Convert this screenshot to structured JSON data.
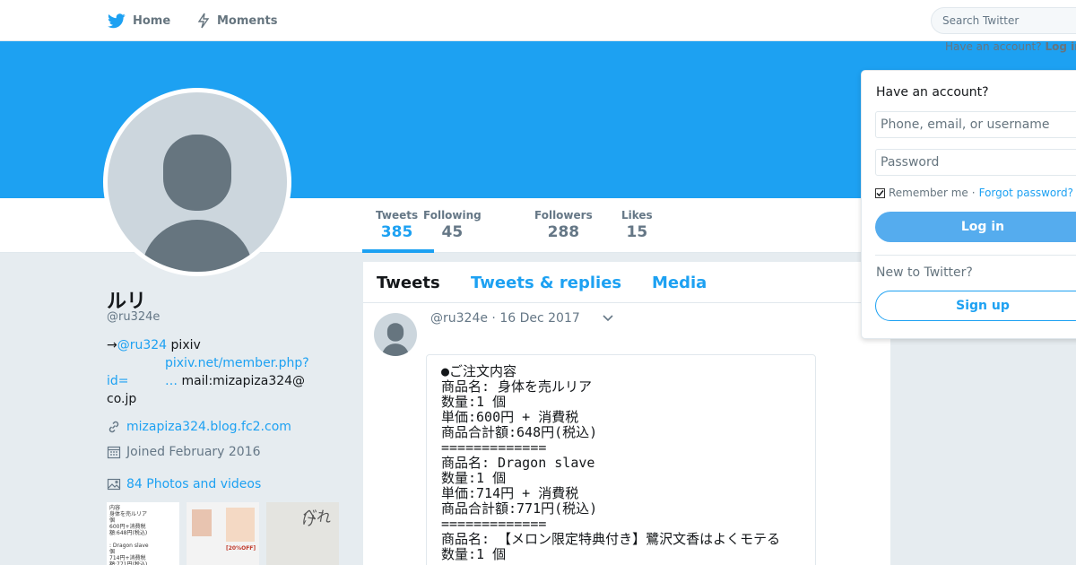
{
  "nav": {
    "home_label": "Home",
    "moments_label": "Moments",
    "search_placeholder": "Search Twitter"
  },
  "header": {
    "have_account_text": "Have an account?",
    "login_link": "Log in"
  },
  "profile": {
    "name": "ルリ",
    "handle": "@ru324e",
    "bio_arrow": "→",
    "bio_mention": "@ru324",
    "bio_pixiv": "pixiv",
    "bio_link": "pixiv.net/member.php?",
    "bio_id": "id=",
    "bio_ellipsis": "…",
    "bio_mail": "mail:mizapiza324@",
    "bio_domain": "co.jp",
    "website": "mizapiza324.blog.fc2.com",
    "joined": "Joined February 2016",
    "photos_label": "84 Photos and videos"
  },
  "stats": [
    {
      "label": "Tweets",
      "value": "385"
    },
    {
      "label": "Following",
      "value": "45"
    },
    {
      "label": "Followers",
      "value": "288"
    },
    {
      "label": "Likes",
      "value": "15"
    }
  ],
  "tabs": {
    "tweets": "Tweets",
    "replies": "Tweets & replies",
    "media": "Media"
  },
  "tweet": {
    "handle": "@ru324e",
    "date": "· 16 Dec 2017",
    "lines": [
      "●ご注文内容",
      "商品名: 身体を売ルリア",
      "数量:1 個",
      "単価:600円 + 消費税",
      "商品合計額:648円(税込)",
      "=============",
      "商品名: Dragon slave",
      "数量:1 個",
      "単価:714円 + 消費税",
      "商品合計額:771円(税込)",
      "=============",
      "商品名: 【メロン限定特典付き】鷺沢文香はよくモテる",
      "数量:1 個"
    ]
  },
  "login": {
    "title": "Have an account?",
    "username_placeholder": "Phone, email, or username",
    "password_placeholder": "Password",
    "remember": "Remember me",
    "separator": "·",
    "forgot": "Forgot password?",
    "login_button": "Log in",
    "new_text": "New to Twitter?",
    "signup_button": "Sign up"
  },
  "thumbnails": {
    "thumb1_text": "内容\n身体を売ルリア\n個\n600円+消費税\n額:648円(税込)\n\n: Dragon slave\n個\n714円+消費税\n額:771円(税込)\n\n【メロン限定特典付き】鷺沢文香はよ",
    "thumb2_text": "[20%OFF]",
    "thumb3_text": "べれけ"
  },
  "colors": {
    "accent": "#1da1f2",
    "banner": "#1da1f2",
    "background": "#e6ecf0"
  }
}
